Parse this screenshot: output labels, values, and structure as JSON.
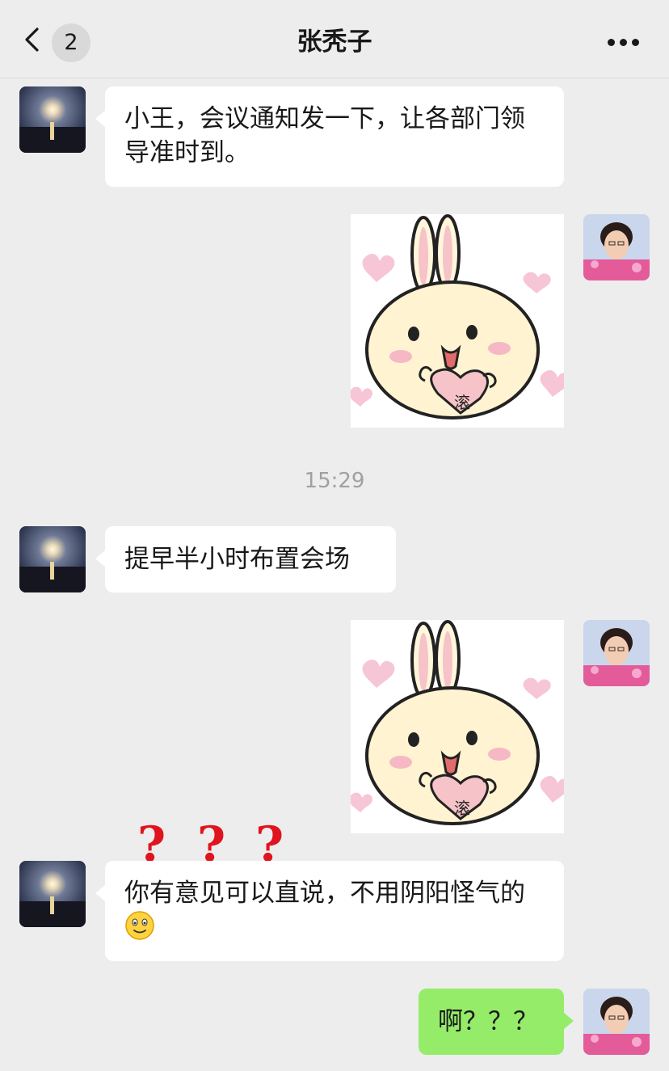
{
  "header": {
    "title": "张秃子",
    "back_badge": "2",
    "icons": {
      "back": "chevron-left-icon",
      "more": "more-dots-icon"
    }
  },
  "messages": {
    "m1": {
      "text": "小王，会议通知发一下，让各部门领导准时到。"
    },
    "s1": {
      "sticker_text": "滚"
    },
    "timestamp": "15:29",
    "m2": {
      "text": "提早半小时布置会场"
    },
    "s2": {
      "sticker_text": "滚"
    },
    "overlay": {
      "q1": "?",
      "q2": "?",
      "q3": "?"
    },
    "m3": {
      "text": "你有意见可以直说，不用阴阳怪气的"
    },
    "m4": {
      "text": "啊？？？"
    }
  },
  "colors": {
    "background": "#ededed",
    "bubble_in": "#ffffff",
    "bubble_out": "#95ec69",
    "timestamp": "#a0a0a0",
    "question_marks": "#e0141e"
  }
}
